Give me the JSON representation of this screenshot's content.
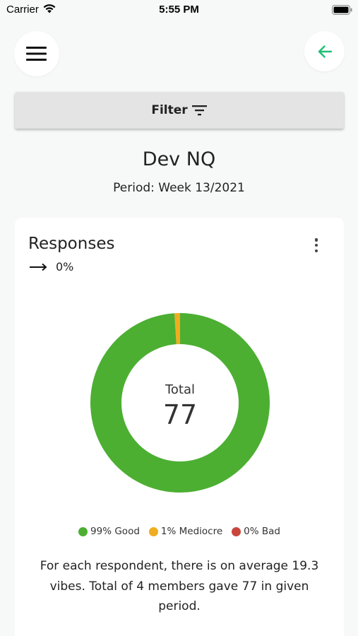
{
  "status_bar": {
    "carrier": "Carrier",
    "time": "5:55 PM"
  },
  "header": {
    "menu_icon": "hamburger-menu-icon",
    "back_icon": "arrow-left-icon",
    "accent_color": "#1dbf73"
  },
  "filter": {
    "label": "Filter",
    "icon": "filter-lines-icon"
  },
  "page": {
    "title": "Dev NQ",
    "period": "Period: Week 13/2021"
  },
  "card": {
    "title": "Responses",
    "trend_icon": "arrow-right-icon",
    "trend_value": "0%",
    "more_icon": "more-vertical-icon",
    "center_label": "Total",
    "center_value": "77",
    "summary": "For each respondent, there is on average 19.3 vibes. Total of 4 members gave 77 in given period."
  },
  "chart_data": {
    "type": "pie",
    "subtype": "donut",
    "series": [
      {
        "name": "Good",
        "value": 99,
        "color": "#4caf32"
      },
      {
        "name": "Mediocre",
        "value": 1,
        "color": "#f0ad1f"
      },
      {
        "name": "Bad",
        "value": 0,
        "color": "#c9463d"
      }
    ],
    "legend": [
      "99% Good",
      "1% Mediocre",
      "0% Bad"
    ],
    "legend_placement": "bottom",
    "center_text": [
      "Total",
      "77"
    ]
  }
}
